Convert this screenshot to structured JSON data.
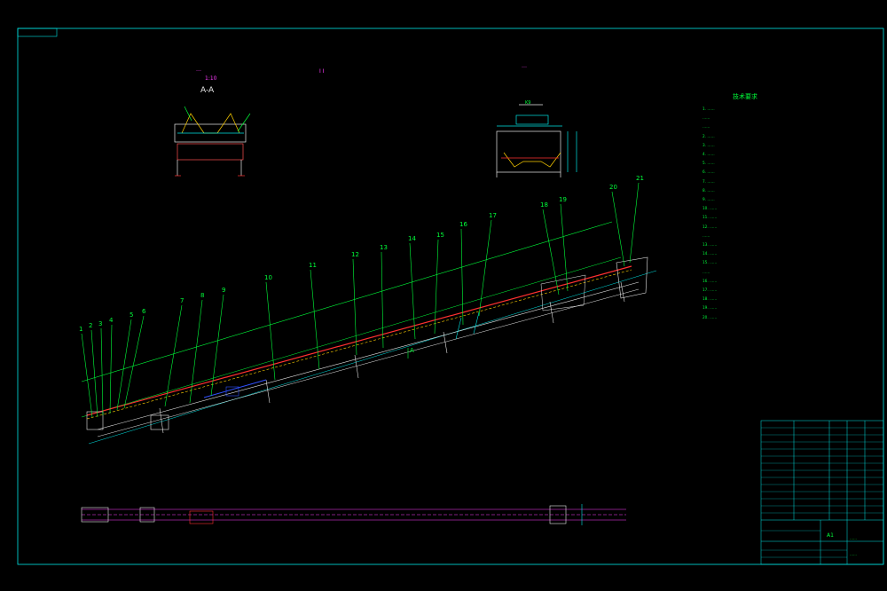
{
  "section_a": {
    "title_red": "…",
    "scale": "1:10",
    "label": "A-A"
  },
  "center_marker": "I I",
  "section_right": {
    "title_red": "…",
    "dim": "K9"
  },
  "tech_requirements": {
    "title": "技术要求",
    "lines": [
      "1. ……",
      "……",
      "……",
      "2. ……",
      "3. ……",
      "4. ……",
      "5. ……",
      "6. ……",
      "7. ……",
      "8. ……",
      "9. ……",
      "10. ……",
      "11. ……",
      "12. ……",
      "……",
      "13. ……",
      "14. ……",
      "15. ……",
      "……",
      "16. ……",
      "17. ……",
      "18. ……",
      "19. ……",
      "20. ……"
    ]
  },
  "callouts": [
    "1",
    "2",
    "3",
    "4",
    "5",
    "6",
    "7",
    "8",
    "9",
    "10",
    "11",
    "12",
    "13",
    "14",
    "15",
    "16",
    "17",
    "18",
    "19",
    "20",
    "21"
  ],
  "section_mark": "A",
  "title_block": {
    "code": "A1",
    "drawing_name": "……",
    "drawing_no": "……"
  },
  "colors": {
    "frame": "#00e5e5",
    "annotation": "#00ff3a",
    "title": "#ff3cff",
    "belt": "#ff3030",
    "belt_alt": "#ffd000",
    "structure": "#e8e8e8"
  }
}
